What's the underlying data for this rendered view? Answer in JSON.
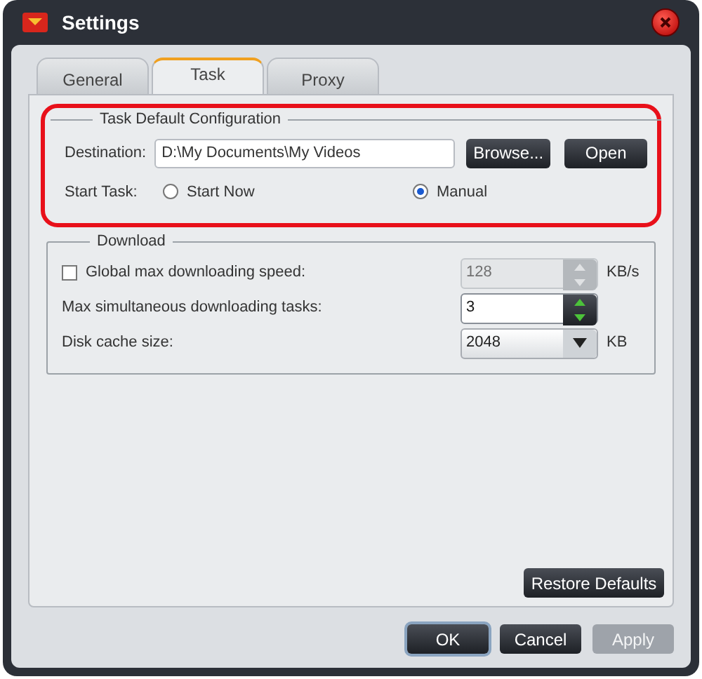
{
  "window": {
    "title": "Settings"
  },
  "tabs": [
    {
      "label": "General",
      "selected": false
    },
    {
      "label": "Task",
      "selected": true
    },
    {
      "label": "Proxy",
      "selected": false
    }
  ],
  "task_config": {
    "legend": "Task Default Configuration",
    "highlighted": true,
    "destination": {
      "label": "Destination:",
      "value": "D:\\My Documents\\My Videos"
    },
    "buttons": [
      "Browse...",
      "Open"
    ],
    "start_task": {
      "label": "Start Task:",
      "options": [
        {
          "label": "Start Now",
          "selected": false
        },
        {
          "label": "Manual",
          "selected": true
        }
      ]
    }
  },
  "download": {
    "legend": "Download",
    "rows": [
      {
        "kind": "spin",
        "label": "Global max downloading speed:",
        "checked": false,
        "value": "128",
        "disabled": true,
        "unit": "KB/s"
      },
      {
        "kind": "spin",
        "label": "Max simultaneous downloading tasks:",
        "value": "3",
        "disabled": false
      },
      {
        "kind": "dropdown",
        "label": "Disk cache size:",
        "value": "2048",
        "unit": "KB"
      }
    ]
  },
  "restore_button": "Restore Defaults",
  "footer_buttons": [
    {
      "label": "OK",
      "disabled": false,
      "focused": true
    },
    {
      "label": "Cancel",
      "disabled": false,
      "focused": false
    },
    {
      "label": "Apply",
      "disabled": true,
      "focused": false
    }
  ]
}
